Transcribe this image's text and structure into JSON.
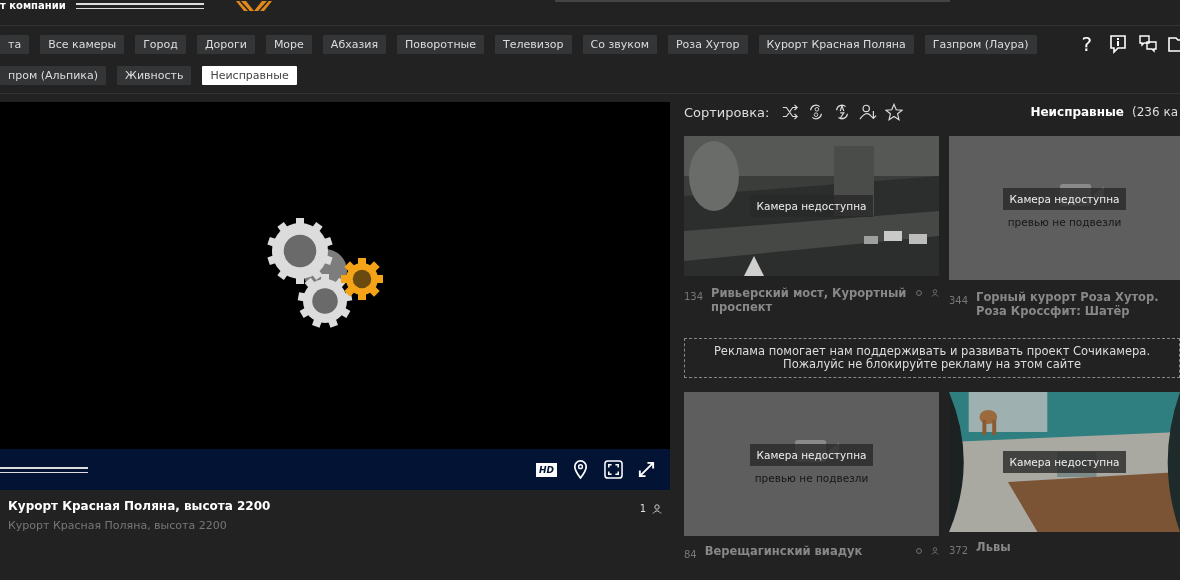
{
  "header": {
    "company_text": "т компании"
  },
  "tab_rows": [
    [
      {
        "label": "та",
        "selected": false
      },
      {
        "label": "Все камеры",
        "selected": false
      },
      {
        "label": "Город",
        "selected": false
      },
      {
        "label": "Дороги",
        "selected": false
      },
      {
        "label": "Море",
        "selected": false
      },
      {
        "label": "Абхазия",
        "selected": false
      },
      {
        "label": "Поворотные",
        "selected": false
      },
      {
        "label": "Телевизор",
        "selected": false
      },
      {
        "label": "Со звуком",
        "selected": false
      },
      {
        "label": "Роза Хутор",
        "selected": false
      },
      {
        "label": "Курорт Красная Поляна",
        "selected": false
      },
      {
        "label": "Газпром (Лаура)",
        "selected": false
      }
    ],
    [
      {
        "label": "пром (Альпика)",
        "selected": false
      },
      {
        "label": "Живность",
        "selected": false
      },
      {
        "label": "Неисправные",
        "selected": true
      }
    ]
  ],
  "help_glyph": "?",
  "player": {
    "title": "Курорт Красная Поляна, высота 2200",
    "subtitle": "Курорт Красная Поляна, высота 2200",
    "viewers": "1",
    "hd_label": "HD"
  },
  "sort": {
    "label": "Сортировка:"
  },
  "list_heading": {
    "title": "Неисправные",
    "count": "(236 ка"
  },
  "cameras": [
    {
      "kind": "street",
      "number": "134",
      "name": "Ривьерский мост, Курортный проспект",
      "status": "Камера недоступна"
    },
    {
      "kind": "no-preview",
      "number": "344",
      "name": "Горный курорт Роза Хутор. Роза Кроссфит: Шатёр",
      "status": "Камера недоступна",
      "note": "превью не подвезли"
    }
  ],
  "ad_text": "Реклама помогает нам поддерживать и развивать проект Сочикамера. Пожалуйс не блокируйте рекламу на этом сайте",
  "cameras_2": [
    {
      "kind": "no-preview",
      "number": "84",
      "name": "Верещагинский виадук",
      "status": "Камера недоступна",
      "note": "превью не подвезли"
    },
    {
      "kind": "enclosure",
      "number": "372",
      "name": "Львы",
      "status": "Камера недоступна"
    }
  ]
}
